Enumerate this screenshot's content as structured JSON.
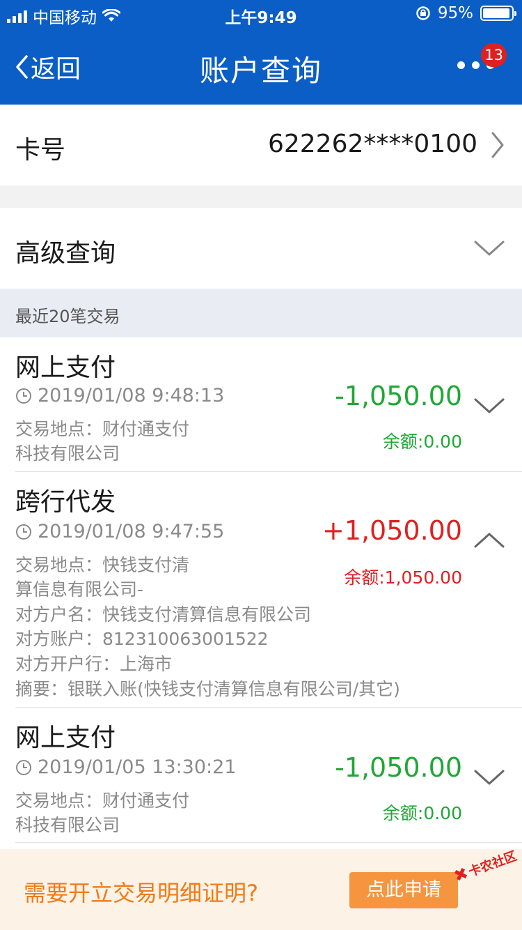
{
  "status_bar": {
    "carrier": "中国移动",
    "time": "上午9:49",
    "battery": "95%",
    "battery_level": 0.95
  },
  "nav": {
    "back_label": "返回",
    "title": "账户查询",
    "badge_count": "13"
  },
  "card": {
    "label": "卡号",
    "number": "622262****0100"
  },
  "advanced": {
    "label": "高级查询"
  },
  "section": {
    "title": "最近20笔交易"
  },
  "transactions": [
    {
      "name": "网上支付",
      "datetime": "2019/01/08 9:48:13",
      "lines": [
        "交易地点：财付通支付",
        "科技有限公司"
      ],
      "amount": "-1,050.00",
      "balance": "余额:0.00",
      "type": "debit",
      "expanded": false
    },
    {
      "name": "跨行代发",
      "datetime": "2019/01/08 9:47:55",
      "lines": [
        "交易地点：快钱支付清",
        "算信息有限公司-",
        "对方户名：快钱支付清算信息有限公司",
        "对方账户：812310063001522",
        "对方开户行：上海市",
        "摘要：银联入账(快钱支付清算信息有限公司/其它)"
      ],
      "amount": "+1,050.00",
      "balance": "余额:1,050.00",
      "type": "credit",
      "expanded": true
    },
    {
      "name": "网上支付",
      "datetime": "2019/01/05 13:30:21",
      "lines": [
        "交易地点：财付通支付",
        "科技有限公司"
      ],
      "amount": "-1,050.00",
      "balance": "余额:0.00",
      "type": "debit",
      "expanded": false
    }
  ],
  "footer": {
    "prompt": "需要开立交易明细证明?",
    "apply_label": "点此申请",
    "watermark": "卡农社区"
  },
  "colors": {
    "header_blue": "#0b5ec6",
    "debit_green": "#1fa836",
    "credit_red": "#e02020",
    "footer_orange": "#f07b16"
  }
}
